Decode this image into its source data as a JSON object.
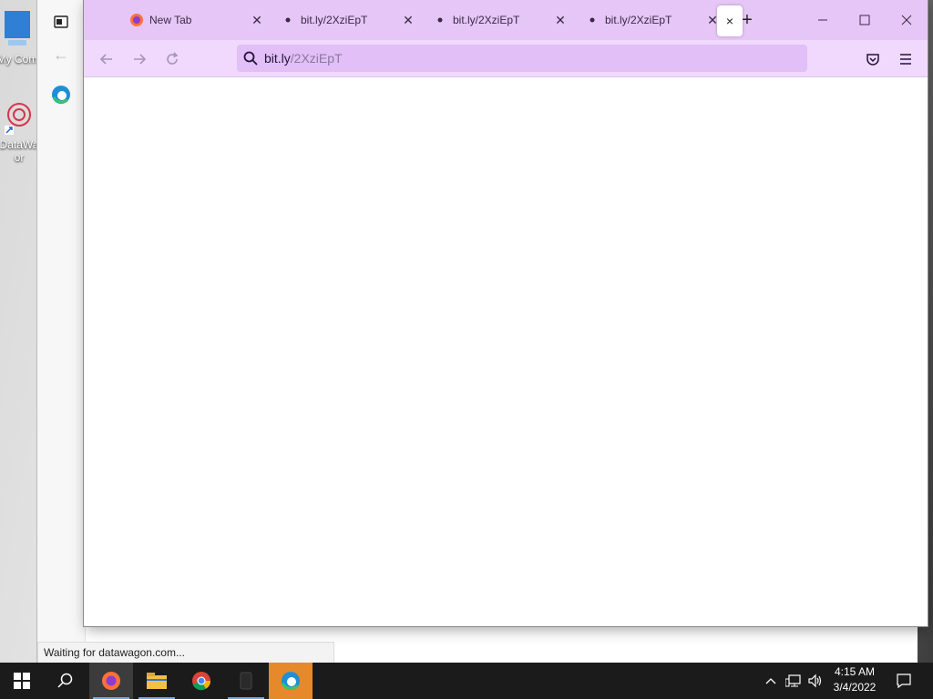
{
  "desktop": {
    "icons": [
      {
        "label": "My Com",
        "icon": "computer-icon"
      },
      {
        "label": "DataWa",
        "sub": "or",
        "icon": "datawagon-icon"
      }
    ]
  },
  "background_window": {
    "status_text": "Waiting for datawagon.com..."
  },
  "browser": {
    "tabs": [
      {
        "label": "New Tab",
        "icon": "firefox-icon"
      },
      {
        "label": "bit.ly/2XziEpT",
        "icon": "loading-dot-icon"
      },
      {
        "label": "bit.ly/2XziEpT",
        "icon": "loading-dot-icon"
      },
      {
        "label": "bit.ly/2XziEpT",
        "icon": "loading-dot-icon"
      }
    ],
    "active_tab_close": "×",
    "new_tab": "+",
    "address": {
      "host": "bit.ly",
      "path": "/2XziEpT"
    },
    "accent": "#e5c6f6"
  },
  "taskbar": {
    "apps": [
      "start-icon",
      "search-icon",
      "firefox-icon",
      "file-explorer-icon",
      "chrome-icon",
      "app-icon",
      "edge-icon"
    ],
    "clock": {
      "time": "4:15 AM",
      "date": "3/4/2022"
    }
  }
}
